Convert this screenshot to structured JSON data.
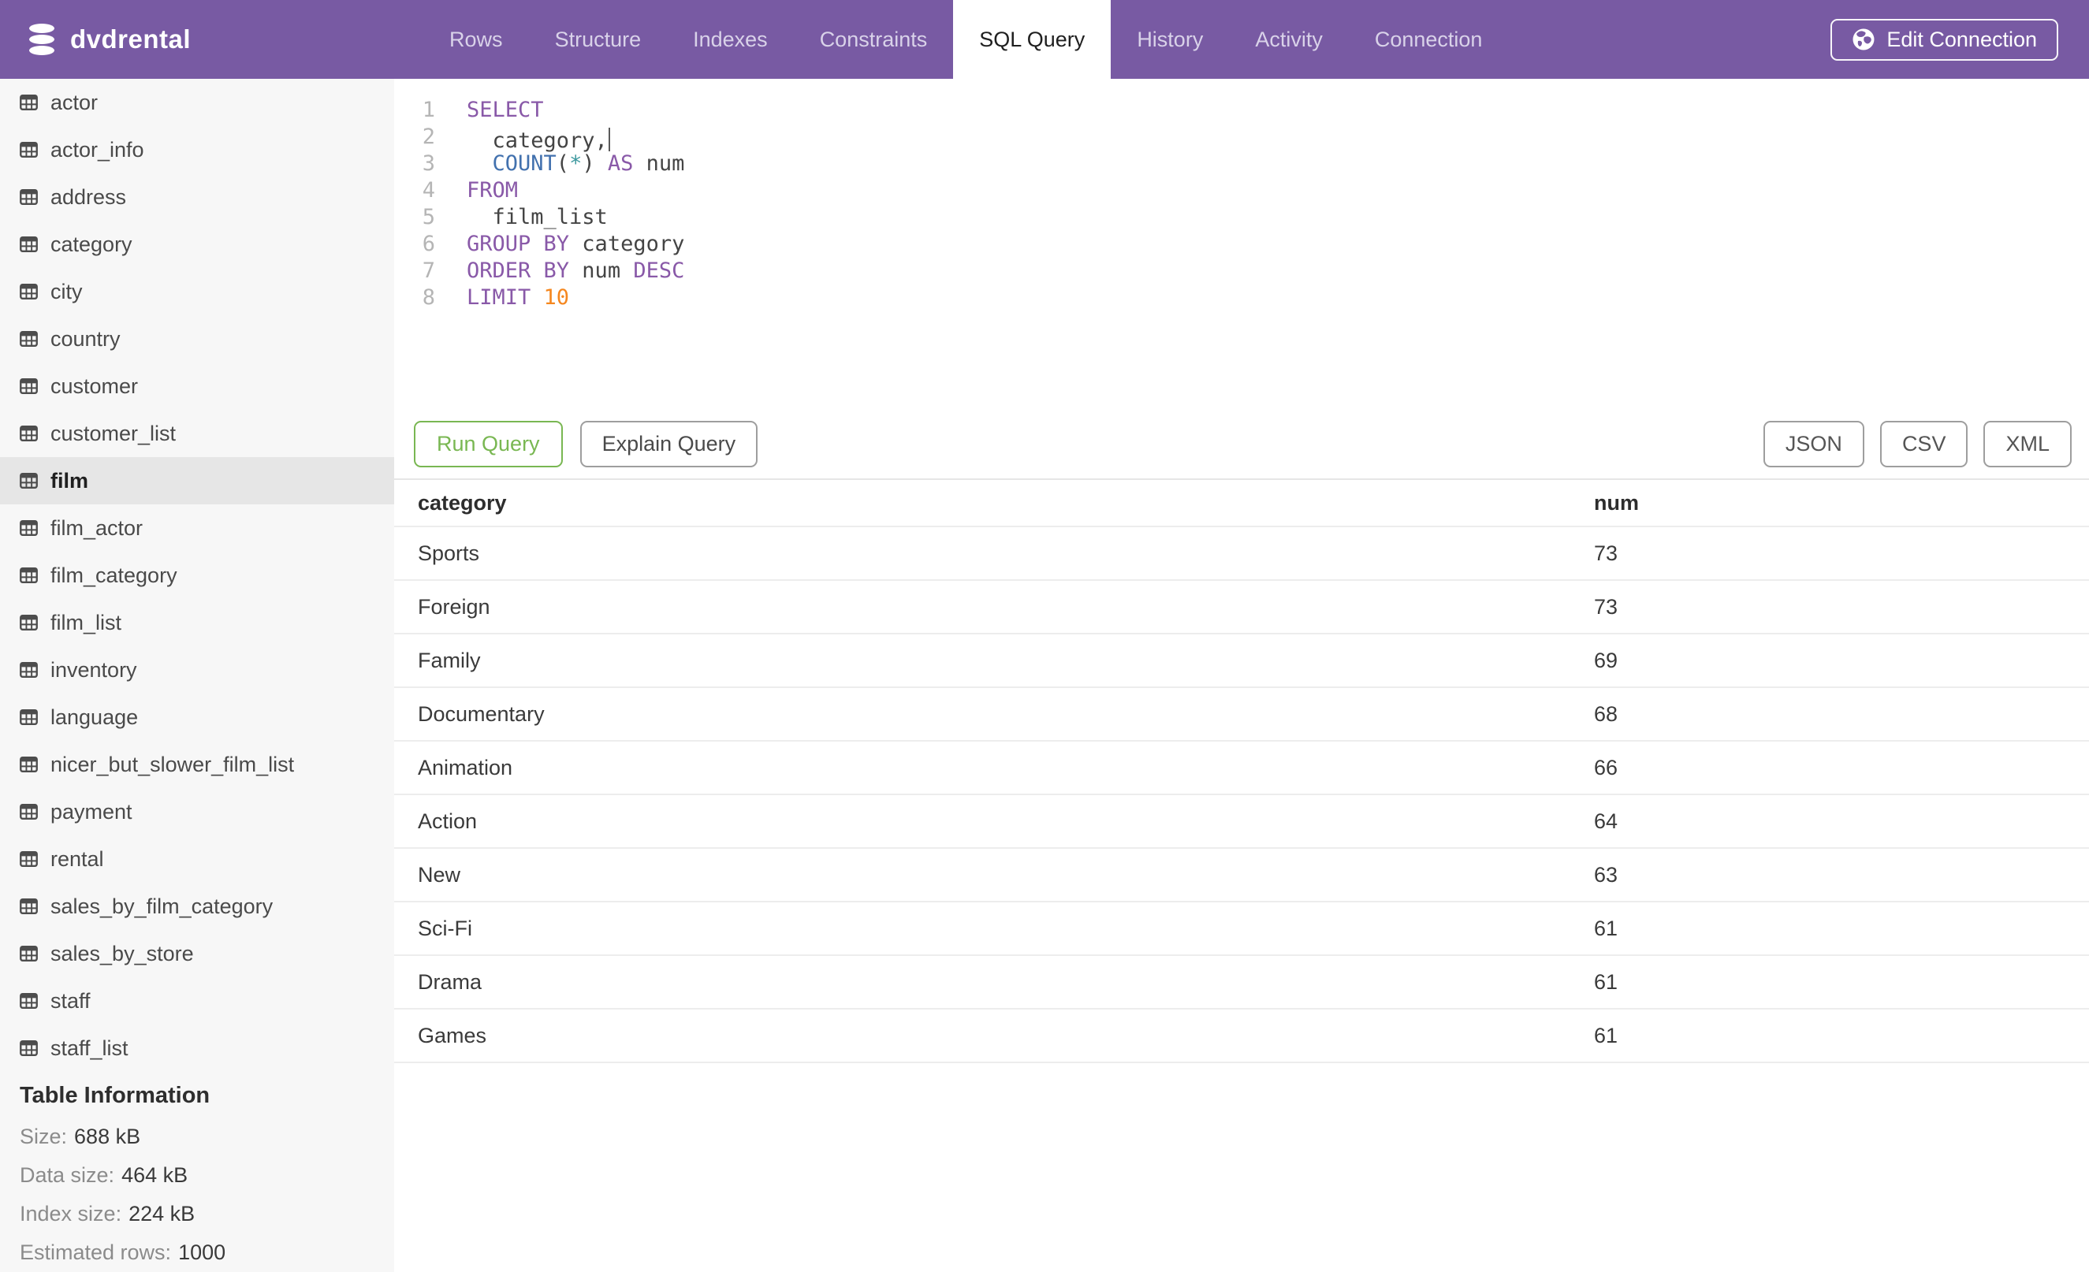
{
  "navbar": {
    "brand": "dvdrental",
    "tabs": [
      {
        "label": "Rows",
        "active": false
      },
      {
        "label": "Structure",
        "active": false
      },
      {
        "label": "Indexes",
        "active": false
      },
      {
        "label": "Constraints",
        "active": false
      },
      {
        "label": "SQL Query",
        "active": true
      },
      {
        "label": "History",
        "active": false
      },
      {
        "label": "Activity",
        "active": false
      },
      {
        "label": "Connection",
        "active": false
      }
    ],
    "edit_connection_label": "Edit Connection"
  },
  "sidebar": {
    "tables": [
      "actor",
      "actor_info",
      "address",
      "category",
      "city",
      "country",
      "customer",
      "customer_list",
      "film",
      "film_actor",
      "film_category",
      "film_list",
      "inventory",
      "language",
      "nicer_but_slower_film_list",
      "payment",
      "rental",
      "sales_by_film_category",
      "sales_by_store",
      "staff",
      "staff_list"
    ],
    "selected_table": "film",
    "table_information": {
      "heading": "Table Information",
      "rows": [
        {
          "label": "Size:",
          "value": "688 kB"
        },
        {
          "label": "Data size:",
          "value": "464 kB"
        },
        {
          "label": "Index size:",
          "value": "224 kB"
        },
        {
          "label": "Estimated rows:",
          "value": "1000"
        }
      ]
    }
  },
  "editor": {
    "sql_text": "SELECT\n  category,\n  COUNT(*) AS num\nFROM\n  film_list\nGROUP BY category\nORDER BY num DESC\nLIMIT 10",
    "lines": [
      {
        "num": 1,
        "tokens": [
          {
            "t": "kw",
            "s": "SELECT"
          }
        ]
      },
      {
        "num": 2,
        "tokens": [
          {
            "t": "txt",
            "s": "  category,"
          }
        ],
        "caret": true
      },
      {
        "num": 3,
        "tokens": [
          {
            "t": "txt",
            "s": "  "
          },
          {
            "t": "fn",
            "s": "COUNT"
          },
          {
            "t": "txt",
            "s": "("
          },
          {
            "t": "aqua",
            "s": "*"
          },
          {
            "t": "txt",
            "s": ") "
          },
          {
            "t": "kw",
            "s": "AS"
          },
          {
            "t": "txt",
            "s": " num"
          }
        ]
      },
      {
        "num": 4,
        "tokens": [
          {
            "t": "kw",
            "s": "FROM"
          }
        ]
      },
      {
        "num": 5,
        "tokens": [
          {
            "t": "txt",
            "s": "  film_list"
          }
        ]
      },
      {
        "num": 6,
        "tokens": [
          {
            "t": "kw",
            "s": "GROUP BY"
          },
          {
            "t": "txt",
            "s": " category"
          }
        ]
      },
      {
        "num": 7,
        "tokens": [
          {
            "t": "kw",
            "s": "ORDER BY"
          },
          {
            "t": "txt",
            "s": " num "
          },
          {
            "t": "kw",
            "s": "DESC"
          }
        ]
      },
      {
        "num": 8,
        "tokens": [
          {
            "t": "kw",
            "s": "LIMIT"
          },
          {
            "t": "txt",
            "s": " "
          },
          {
            "t": "num",
            "s": "10"
          }
        ]
      }
    ]
  },
  "actions": {
    "run_label": "Run Query",
    "explain_label": "Explain Query",
    "exports": [
      "JSON",
      "CSV",
      "XML"
    ]
  },
  "results": {
    "columns": [
      "category",
      "num"
    ],
    "rows": [
      [
        "Sports",
        "73"
      ],
      [
        "Foreign",
        "73"
      ],
      [
        "Family",
        "69"
      ],
      [
        "Documentary",
        "68"
      ],
      [
        "Animation",
        "66"
      ],
      [
        "Action",
        "64"
      ],
      [
        "New",
        "63"
      ],
      [
        "Sci-Fi",
        "61"
      ],
      [
        "Drama",
        "61"
      ],
      [
        "Games",
        "61"
      ]
    ]
  },
  "colors": {
    "navbar_purple": "#785aa3",
    "navbar_tab_text": "#d9d2e9",
    "active_tab_bg": "#ffffff",
    "run_green": "#79b752",
    "keyword_purple": "#8959a8",
    "function_blue": "#4271ae",
    "star_teal": "#3e999f",
    "number_orange": "#f5871f",
    "sidebar_bg": "#f7f7f7",
    "selected_item_bg": "#e6e6e6"
  }
}
